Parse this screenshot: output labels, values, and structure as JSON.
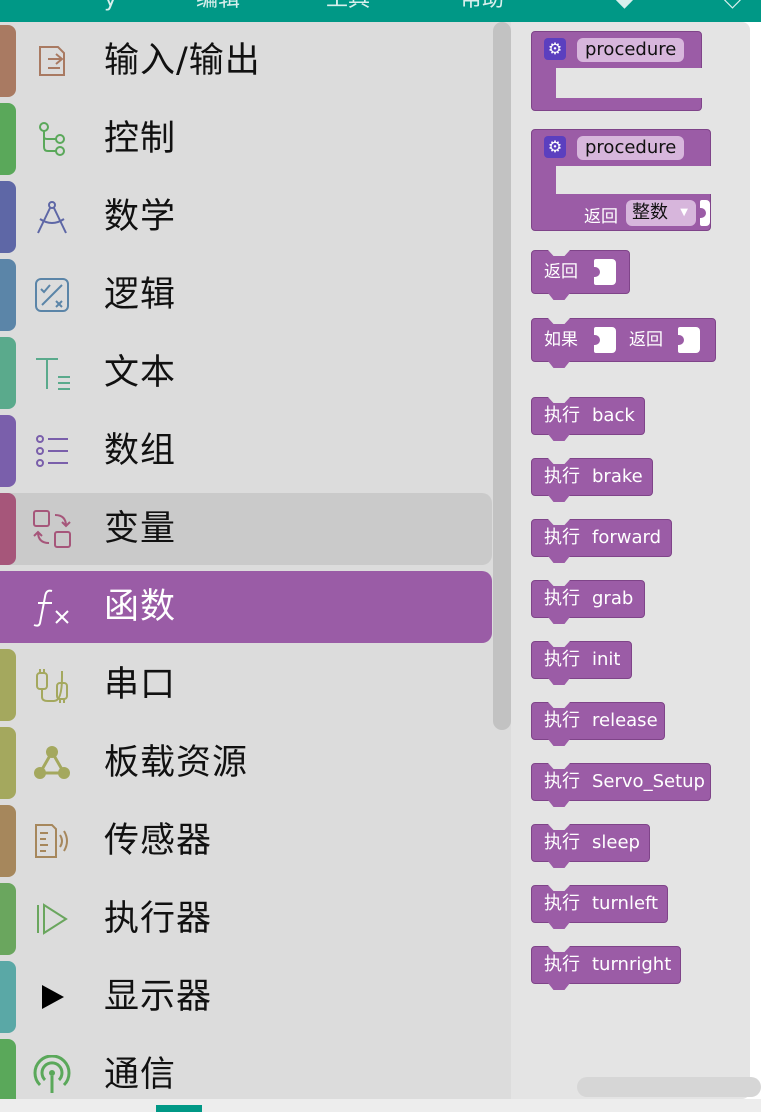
{
  "top_bar": {
    "fragments": [
      "y",
      "编辑",
      "工具",
      "帮助",
      "◆",
      "◇"
    ]
  },
  "categories": [
    {
      "label": "输入/输出",
      "icon": "io-icon",
      "color": "#a97a62"
    },
    {
      "label": "控制",
      "icon": "control-flow-icon",
      "color": "#5aa85a"
    },
    {
      "label": "数学",
      "icon": "compass-icon",
      "color": "#5e67a6"
    },
    {
      "label": "逻辑",
      "icon": "logic-icon",
      "color": "#5b85a8"
    },
    {
      "label": "文本",
      "icon": "text-icon",
      "color": "#5aaa8c"
    },
    {
      "label": "数组",
      "icon": "list-icon",
      "color": "#7a5fab"
    },
    {
      "label": "变量",
      "icon": "variable-icon",
      "color": "#a6567a"
    },
    {
      "label": "函数",
      "icon": "function-icon",
      "color": "#9b5ca6"
    },
    {
      "label": "串口",
      "icon": "serial-icon",
      "color": "#a4a85e"
    },
    {
      "label": "板载资源",
      "icon": "board-resource-icon",
      "color": "#a4a85e"
    },
    {
      "label": "传感器",
      "icon": "sensor-icon",
      "color": "#a6875c"
    },
    {
      "label": "执行器",
      "icon": "actuator-icon",
      "color": "#6aa65e"
    },
    {
      "label": "显示器",
      "icon": "display-icon",
      "color": "#5aa8a6"
    },
    {
      "label": "通信",
      "icon": "communication-icon",
      "color": "#5aa85a"
    }
  ],
  "selected_category": "函数",
  "hovered_category": "变量",
  "blocks": {
    "procedure_noreturn": {
      "name": "procedure"
    },
    "procedure_return": {
      "name": "procedure",
      "return_label": "返回",
      "return_type": "整数"
    },
    "return": {
      "label": "返回"
    },
    "if_return": {
      "if_label": "如果",
      "return_label": "返回"
    },
    "call_keyword": "执行",
    "calls": [
      "back",
      "brake",
      "forward",
      "grab",
      "init",
      "release",
      "Servo_Setup",
      "sleep",
      "turnleft",
      "turnright"
    ]
  }
}
